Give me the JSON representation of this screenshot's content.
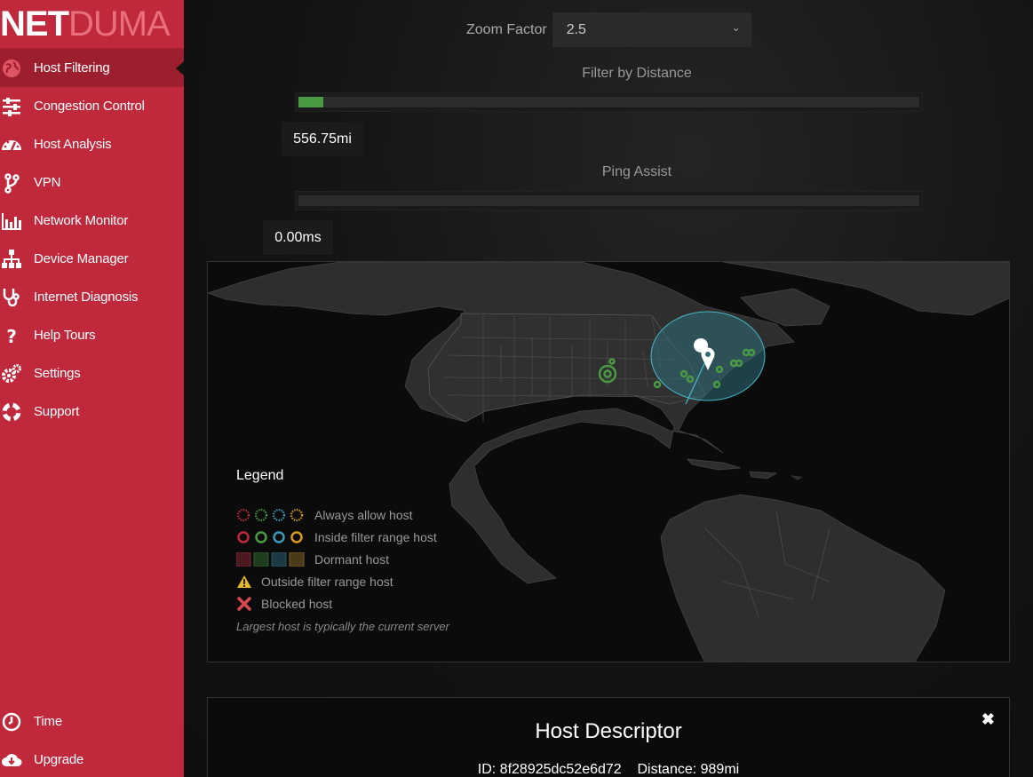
{
  "brand": {
    "part1": "NET",
    "part2": "DUMA"
  },
  "nav": {
    "items": [
      {
        "label": "Host Filtering",
        "icon": "globe-icon"
      },
      {
        "label": "Congestion Control",
        "icon": "sliders-icon"
      },
      {
        "label": "Host Analysis",
        "icon": "gauge-icon"
      },
      {
        "label": "VPN",
        "icon": "branch-icon"
      },
      {
        "label": "Network Monitor",
        "icon": "bar-chart-icon"
      },
      {
        "label": "Device Manager",
        "icon": "network-tree-icon"
      },
      {
        "label": "Internet Diagnosis",
        "icon": "stethoscope-icon"
      },
      {
        "label": "Help Tours",
        "icon": "question-icon"
      },
      {
        "label": "Settings",
        "icon": "gears-icon"
      },
      {
        "label": "Support",
        "icon": "lifebuoy-icon"
      }
    ],
    "bottom": [
      {
        "label": "Time",
        "icon": "clock-icon"
      },
      {
        "label": "Upgrade",
        "icon": "cloud-download-icon"
      }
    ]
  },
  "controls": {
    "zoom_label": "Zoom Factor",
    "zoom_value": "2.5",
    "distance_label": "Filter by Distance",
    "distance_value": "556.75mi",
    "distance_fill_fraction": 0.04,
    "ping_label": "Ping Assist",
    "ping_value": "0.00ms",
    "ping_fill_fraction": 0.0
  },
  "legend": {
    "title": "Legend",
    "rows": [
      "Always allow host",
      "Inside filter range host",
      "Dormant host",
      "Outside filter range host",
      "Blocked host"
    ],
    "note": "Largest host is typically the current server"
  },
  "host": {
    "title": "Host Descriptor",
    "id_text": "ID: 8f28925dc52e6d72",
    "distance_text": "Distance: 989mi"
  },
  "colors": {
    "sidebar": "#c0283b",
    "active": "#9d1f2f",
    "green": "#4a9a44",
    "red": "#c0283b",
    "blue": "#3a9ab8",
    "orange": "#d89a1e"
  }
}
